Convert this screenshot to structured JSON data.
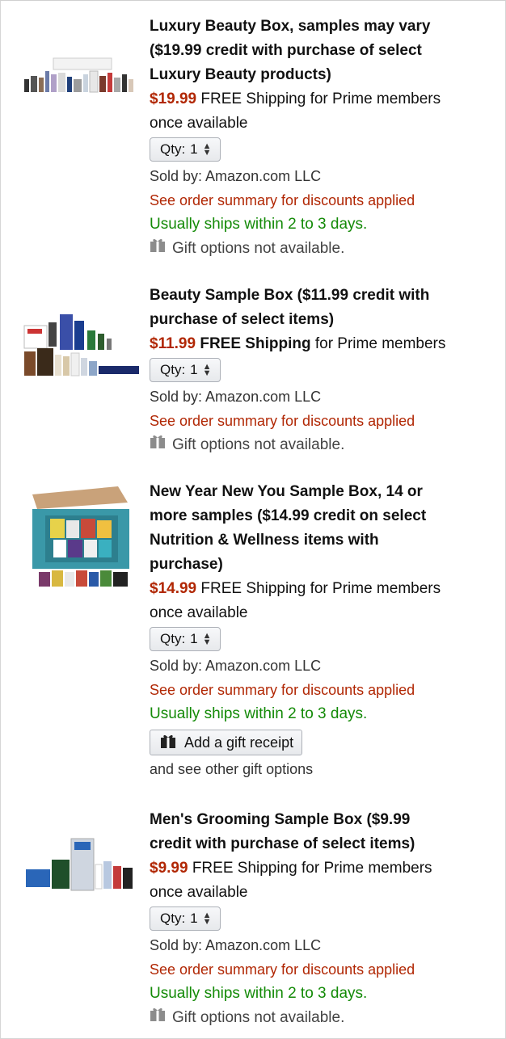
{
  "items": [
    {
      "title": [
        "Luxury Beauty Box, samples may vary",
        "($19.99 credit with purchase of select",
        "Luxury Beauty products)"
      ],
      "price": "$19.99",
      "shipping_prefix": "FREE Shipping",
      "shipping_suffix": " for Prime members",
      "shipping_line2": "once available",
      "qty_label": "Qty:",
      "qty_value": "1",
      "sold_by": "Sold by: Amazon.com LLC",
      "discount": "See order summary for discounts applied",
      "ships": "Usually ships within 2 to 3 days.",
      "gift": "Gift options not available."
    },
    {
      "title": [
        "Beauty Sample Box ($11.99 credit with",
        "purchase of select items)"
      ],
      "price": "$11.99",
      "shipping_prefix": "FREE Shipping",
      "shipping_suffix": " for Prime members",
      "qty_label": "Qty:",
      "qty_value": "1",
      "sold_by": "Sold by: Amazon.com LLC",
      "discount": "See order summary for discounts applied",
      "gift": "Gift options not available."
    },
    {
      "title": [
        "New Year New You Sample Box, 14 or",
        "more samples ($14.99 credit on select",
        "Nutrition & Wellness items with",
        "purchase)"
      ],
      "price": "$14.99",
      "shipping_prefix": "FREE Shipping",
      "shipping_suffix": " for Prime members",
      "shipping_line2": "once available",
      "qty_label": "Qty:",
      "qty_value": "1",
      "sold_by": "Sold by: Amazon.com LLC",
      "discount": "See order summary for discounts applied",
      "ships": "Usually ships within 2 to 3 days.",
      "gift_button": "Add a gift receipt",
      "gift_more": "and see other gift options"
    },
    {
      "title": [
        "Men's Grooming Sample Box ($9.99",
        "credit with purchase of select items)"
      ],
      "price": "$9.99",
      "shipping_prefix": "FREE Shipping",
      "shipping_suffix": " for Prime members",
      "shipping_line2": "once available",
      "qty_label": "Qty:",
      "qty_value": "1",
      "sold_by": "Sold by: Amazon.com LLC",
      "discount": "See order summary for discounts applied",
      "ships": "Usually ships within 2 to 3 days.",
      "gift": "Gift options not available."
    }
  ],
  "colors": {
    "price": "#b12704",
    "ships": "#138a07",
    "discount": "#b12704"
  },
  "icons": {
    "gift": "gift-icon",
    "qty_arrows": "updown-arrows-icon"
  }
}
